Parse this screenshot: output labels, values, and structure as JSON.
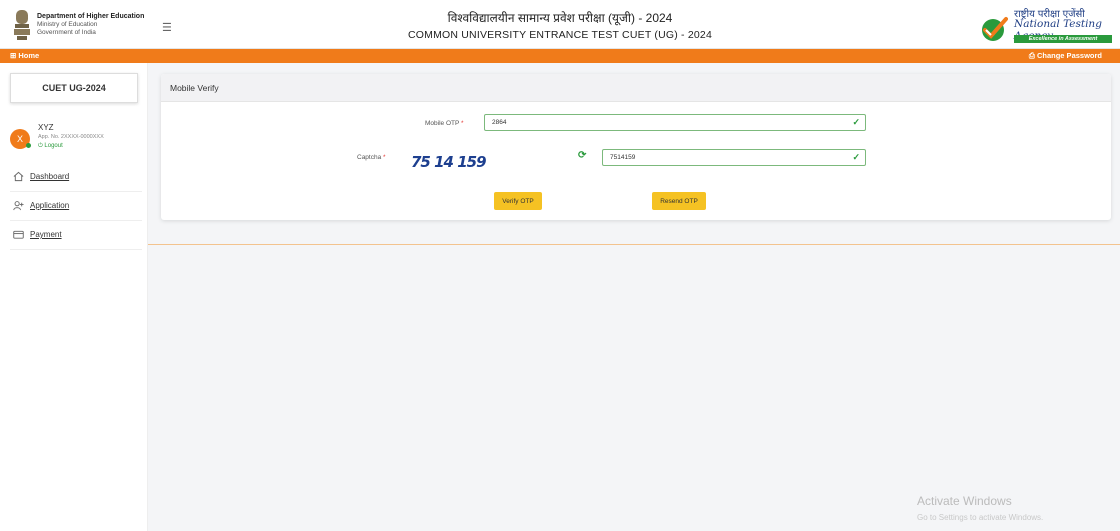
{
  "header": {
    "dept_line1": "Department of Higher Education",
    "dept_line2": "Ministry of Education",
    "dept_line3": "Government of India",
    "title_hindi": "विश्वविद्यालयीन सामान्य प्रवेश परीक्षा (यूजी) - 2024",
    "title_english": "COMMON UNIVERSITY ENTRANCE TEST CUET (UG) - 2024",
    "nta_hindi": "राष्ट्रीय परीक्षा एजेंसी",
    "nta_english": "National Testing Agency",
    "nta_tagline": "Excellence in Assessment",
    "menu_icon": "hamburger-icon",
    "emblem_icon": "national-emblem-icon",
    "nta_logo_icon": "nta-checkmark-logo"
  },
  "topbar": {
    "home_label": "⊞ Home",
    "change_password_label": "⎙ Change Password",
    "color": "#f07b1a"
  },
  "sidebar": {
    "exam_card": "CUET UG-2024",
    "user": {
      "initial": "X",
      "name": "XYZ",
      "app_no": "App. No. 2XXXX-0000XXX",
      "logout_label": "⏻ Logout"
    },
    "items": [
      {
        "label": "Dashboard",
        "icon": "home-icon"
      },
      {
        "label": "Application",
        "icon": "user-add-icon"
      },
      {
        "label": "Payment",
        "icon": "card-icon"
      }
    ]
  },
  "main": {
    "card_title": "Mobile Verify",
    "mobile_otp_label": "Mobile OTP",
    "mobile_otp_value": "2864",
    "captcha_label": "Captcha",
    "captcha_image_text": "75 14 159",
    "captcha_value": "7514159",
    "required_mark": "*",
    "verify_button": "Verify OTP",
    "resend_button": "Resend OTP",
    "valid_icon": "check-icon",
    "refresh_icon": "refresh-icon"
  },
  "watermark": {
    "title": "Activate Windows",
    "subtitle": "Go to Settings to activate Windows."
  },
  "colors": {
    "accent": "#f07b1a",
    "button": "#f5c223",
    "success": "#2a9a3c",
    "brand_blue": "#1f3e84"
  }
}
